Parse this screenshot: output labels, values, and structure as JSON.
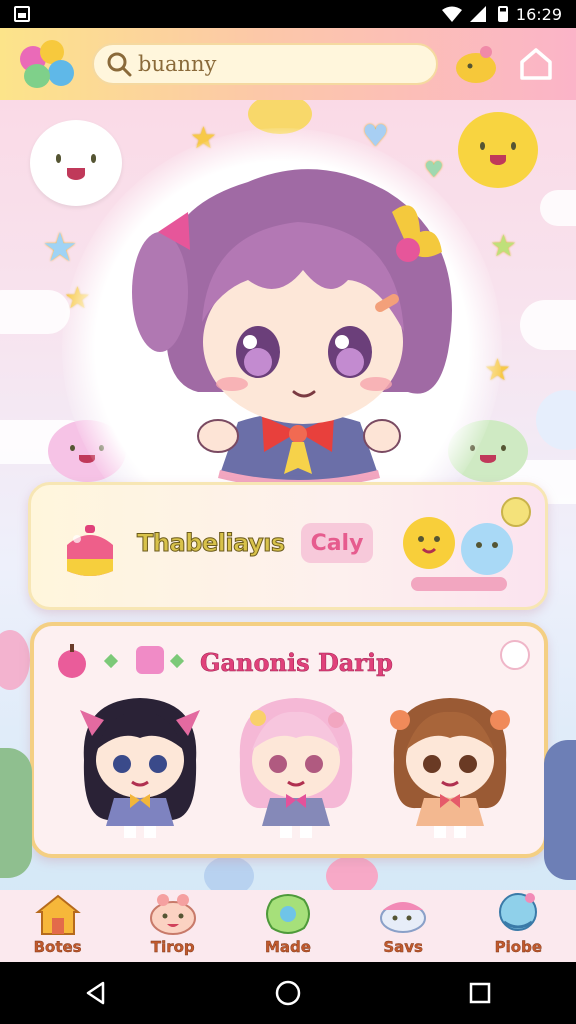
{
  "status_bar": {
    "time": "16:29"
  },
  "app_bar": {
    "search_text": "buanny"
  },
  "profile_card": {
    "name": "Thabeliayıs",
    "tag": "Caly"
  },
  "group_card": {
    "title": "Ganonis Darip"
  },
  "bottom_nav": {
    "items": [
      {
        "label": "Botes",
        "icon": "home-icon"
      },
      {
        "label": "Tirop",
        "icon": "pet-face-icon"
      },
      {
        "label": "Made",
        "icon": "puzzle-icon"
      },
      {
        "label": "Savs",
        "icon": "whale-icon"
      },
      {
        "label": "Piobe",
        "icon": "balloon-icon"
      }
    ]
  },
  "colors": {
    "accent_pink": "#e0417a",
    "accent_gold": "#f4cf83",
    "bar_start": "#fce48a",
    "bar_end": "#fbb4c8"
  }
}
